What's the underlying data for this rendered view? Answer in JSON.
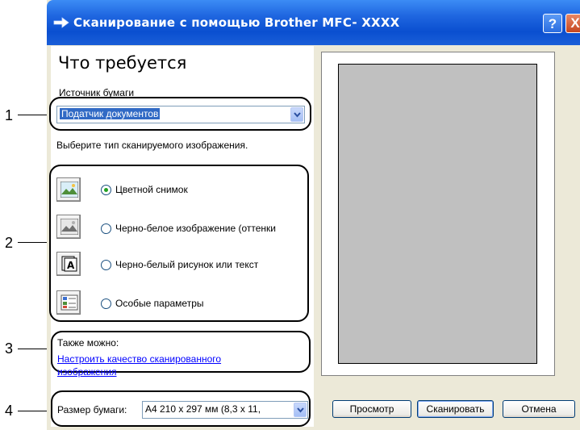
{
  "window": {
    "title": "Сканирование с помощью Brother MFC- XXXX",
    "help_label": "?",
    "close_label": "X"
  },
  "panel": {
    "heading": "Что требуется",
    "paper_source_label": "Источник бумаги",
    "paper_source_value": "Податчик документов",
    "scan_type_prompt": "Выберите тип сканируемого изображения.",
    "options": [
      {
        "label": "Цветной снимок",
        "checked": true,
        "icon": "color-photo-icon"
      },
      {
        "label": "Черно-белое изображение (оттенки",
        "checked": false,
        "icon": "grayscale-photo-icon"
      },
      {
        "label": "Черно-белый рисунок или текст",
        "checked": false,
        "icon": "bw-text-icon"
      },
      {
        "label": "Особые параметры",
        "checked": false,
        "icon": "custom-settings-icon"
      }
    ],
    "also_label": "Также можно:",
    "adjust_link": "Настроить качество сканированного изображения",
    "adjust_link_line1": "Настроить качество сканированного",
    "adjust_link_line2": "изображения",
    "paper_size_label": "Размер бумаги:",
    "paper_size_value": "A4 210 x 297 мм (8,3 x 11,"
  },
  "buttons": {
    "preview": "Просмотр",
    "scan": "Сканировать",
    "cancel": "Отмена"
  },
  "callouts": [
    "1",
    "2",
    "3",
    "4"
  ],
  "colors": {
    "titlebar": "#0a4fd0",
    "dialog_bg": "#ece9d8",
    "selection": "#316ac5",
    "link": "#0000ff",
    "preview_area": "#c0c0c0"
  }
}
